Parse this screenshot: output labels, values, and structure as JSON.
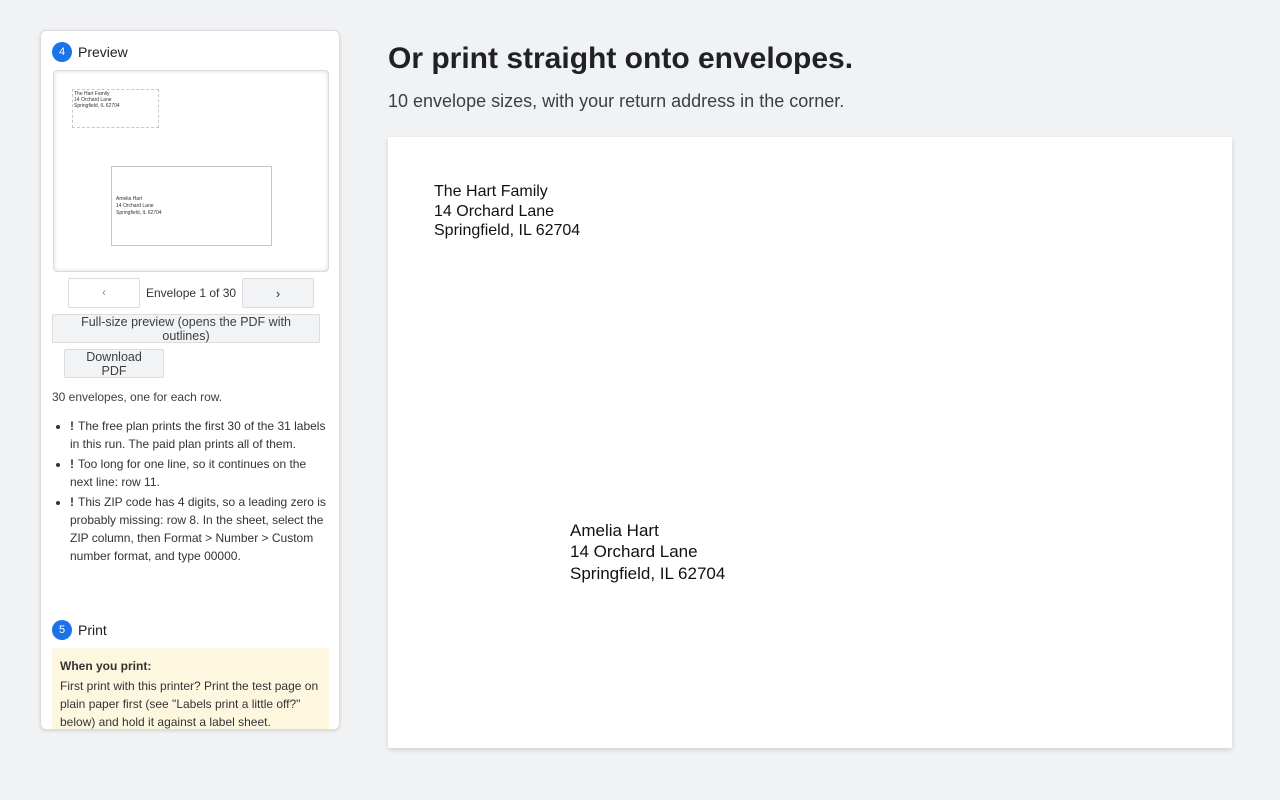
{
  "preview_step": {
    "number": "4",
    "title": "Preview"
  },
  "print_step": {
    "number": "5",
    "title": "Print"
  },
  "return_address": {
    "line1": "The Hart Family",
    "line2": "14 Orchard Lane",
    "line3": "Springfield, IL 62704"
  },
  "recipient_address": {
    "line1": "Amelia Hart",
    "line2": "14 Orchard Lane",
    "line3": "Springfield, IL 62704"
  },
  "pager": {
    "prev": "‹",
    "label": "Envelope 1 of 30",
    "next": "›"
  },
  "buttons": {
    "full_preview": "Full-size preview (opens the PDF with outlines)",
    "download": "Download PDF"
  },
  "summary": "30 envelopes, one for each row.",
  "warnings": [
    {
      "mark": "!",
      "text": "The free plan prints the first 30 of the 31 labels in this run. The paid plan prints all of them."
    },
    {
      "mark": "!",
      "text": "Too long for one line, so it continues on the next line: row 11."
    },
    {
      "mark": "!",
      "text": "This ZIP code has 4 digits, so a leading zero is probably missing: row 8. In the sheet, select the ZIP column, then Format > Number > Custom number format, and type 00000."
    }
  ],
  "print_notice": {
    "title": "When you print:",
    "text": "First print with this printer? Print the test page on plain paper first (see \"Labels print a little off?\" below) and hold it against a label sheet."
  },
  "main": {
    "headline": "Or print straight onto envelopes.",
    "subline": "10 envelope sizes, with your return address in the corner."
  },
  "colors": {
    "accent": "#1a73e8",
    "notice_bg": "#fef7e0",
    "page_bg": "#f1f2f4"
  }
}
